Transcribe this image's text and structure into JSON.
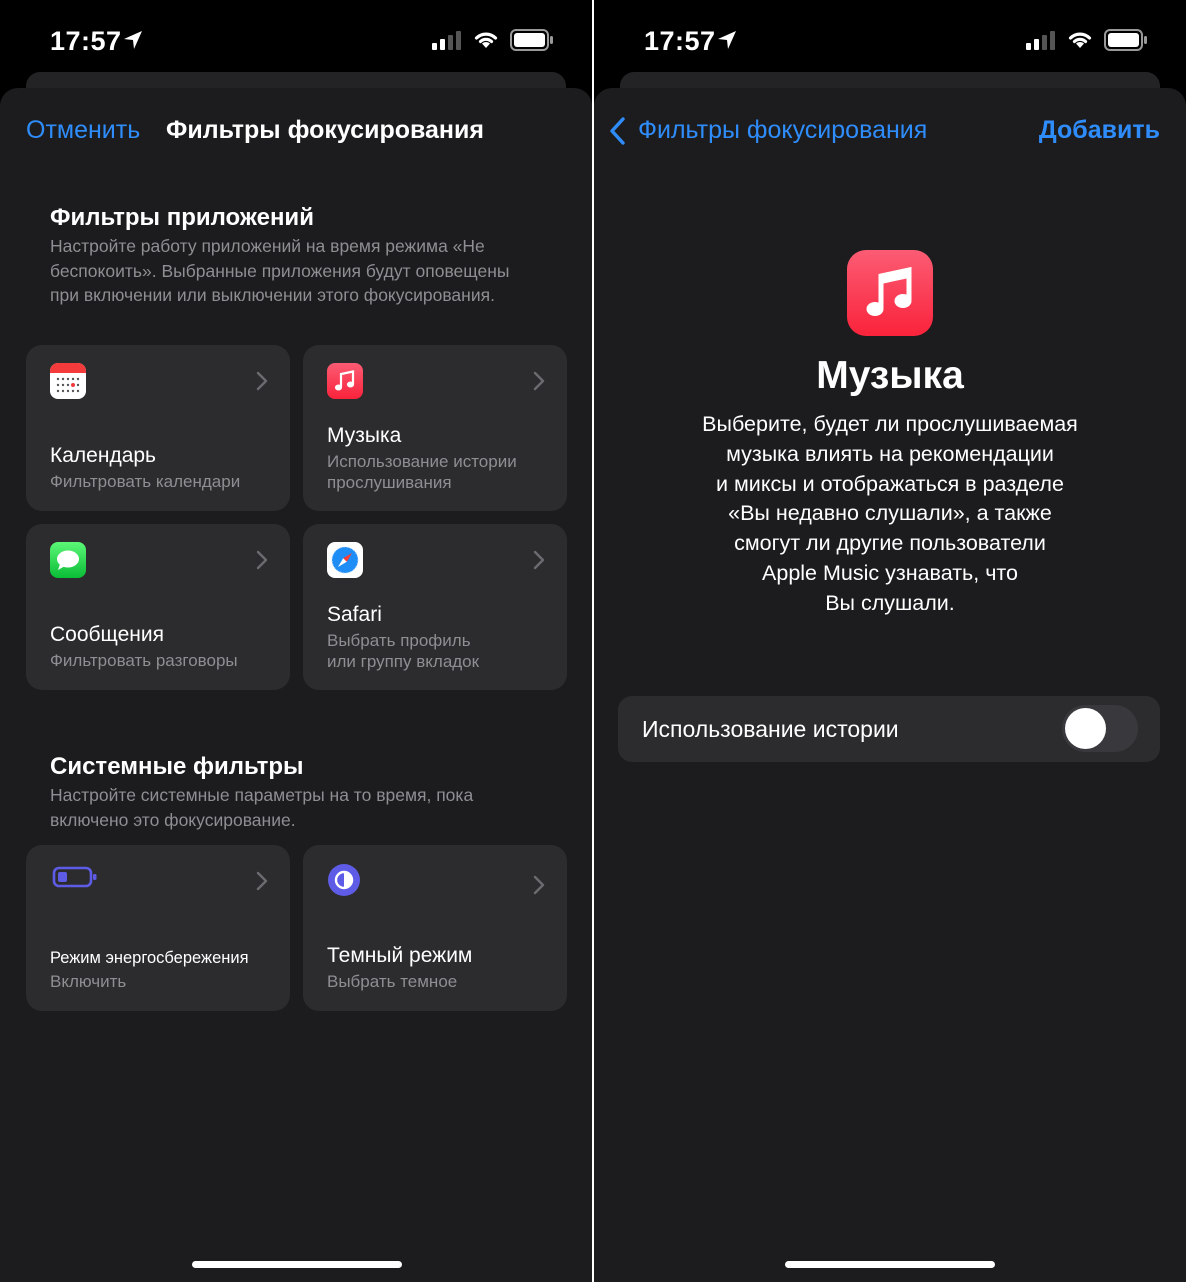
{
  "colors": {
    "accent": "#2f8dfb",
    "background": "#000000",
    "sheet": "#1c1c1e",
    "card": "#2c2c2e",
    "secondary_text": "#8e8e93",
    "music_red": "#fa2d48",
    "power_purple": "#5e5ce6"
  },
  "left": {
    "status": {
      "time": "17:57"
    },
    "nav": {
      "cancel": "Отменить",
      "title": "Фильтры фокусирования"
    },
    "app_filters": {
      "title": "Фильтры приложений",
      "description": "Настройте работу приложений на время режима «Не беспокоить». Выбранные приложения будут оповещены при включении или выключении этого фокусирования.",
      "cards": [
        {
          "icon": "calendar-icon",
          "title": "Календарь",
          "subtitle": "Фильтровать календари"
        },
        {
          "icon": "music-icon",
          "title": "Музыка",
          "subtitle_line1": "Использование истории",
          "subtitle_line2": "прослушивания"
        },
        {
          "icon": "messages-icon",
          "title": "Сообщения",
          "subtitle": "Фильтровать разговоры"
        },
        {
          "icon": "safari-icon",
          "title": "Safari",
          "subtitle_line1": "Выбрать профиль",
          "subtitle_line2": "или группу вкладок"
        }
      ]
    },
    "system_filters": {
      "title": "Системные фильтры",
      "description": "Настройте системные параметры на то время, пока включено это фокусирование.",
      "cards": [
        {
          "icon": "low-power-battery-icon",
          "title": "Режим энергосбережения",
          "subtitle": "Включить"
        },
        {
          "icon": "dark-mode-icon",
          "title": "Темный режим",
          "subtitle": "Выбрать темное"
        }
      ]
    }
  },
  "right": {
    "status": {
      "time": "17:57"
    },
    "nav": {
      "back": "Фильтры фокусирования",
      "add": "Добавить"
    },
    "app": {
      "icon": "music-icon",
      "name": "Музыка",
      "description_lines": [
        "Выберите, будет ли прослушиваемая",
        "музыка влиять на рекомендации",
        "и миксы и отображаться в разделе",
        "«Вы недавно слушали», а также",
        "смогут ли другие пользователи",
        "Apple Music узнавать, что",
        "Вы слушали."
      ]
    },
    "toggle": {
      "label": "Использование истории",
      "on": false
    }
  }
}
